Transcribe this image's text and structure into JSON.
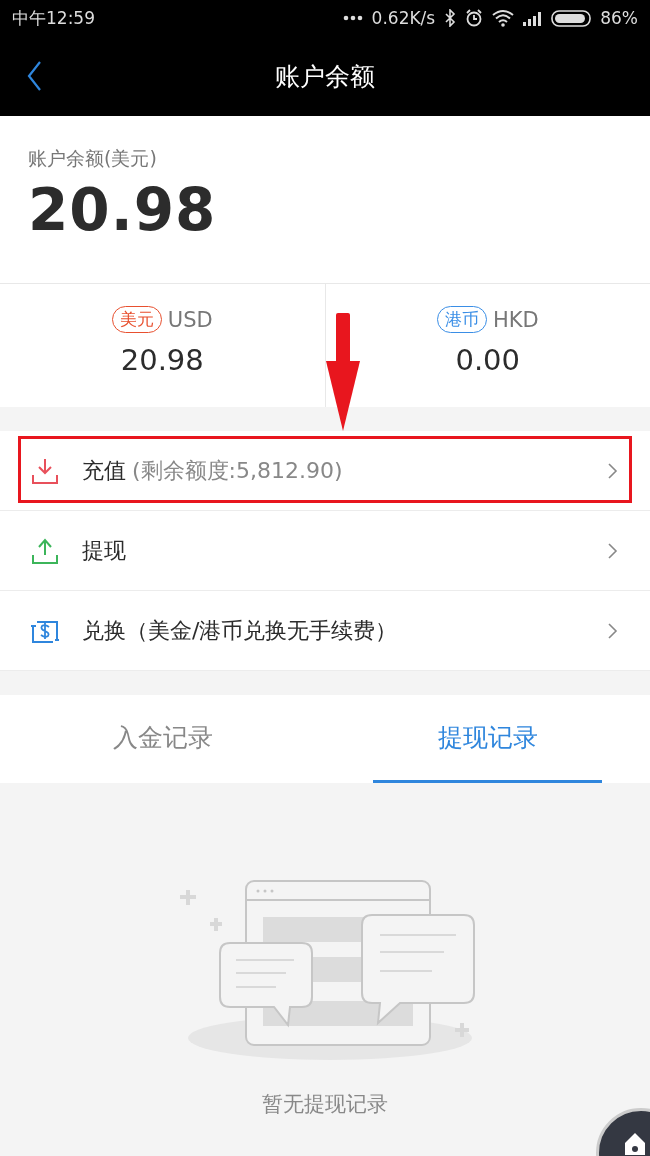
{
  "status_bar": {
    "time": "中午12:59",
    "network_speed": "0.62K/s",
    "battery": "86%"
  },
  "header": {
    "title": "账户余额"
  },
  "balance": {
    "label": "账户余额(美元)",
    "amount": "20.98"
  },
  "currencies": [
    {
      "tag": "美元",
      "code": "USD",
      "amount": "20.98",
      "color": "#e8502f"
    },
    {
      "tag": "港币",
      "code": "HKD",
      "amount": "0.00",
      "color": "#3a8ee6"
    }
  ],
  "actions": [
    {
      "kind": "deposit",
      "label": "充值",
      "note": "(剩余额度:5,812.90)",
      "color": "#e8505b",
      "highlighted": true
    },
    {
      "kind": "withdraw",
      "label": "提现",
      "color": "#3cb55a",
      "highlighted": false
    },
    {
      "kind": "exchange",
      "label": "兑换（美金/港币兑换无手续费）",
      "color": "#2f86dd",
      "highlighted": false
    }
  ],
  "tabs": [
    {
      "label": "入金记录",
      "selected": false
    },
    {
      "label": "提现记录",
      "selected": true
    }
  ],
  "empty_state": {
    "message": "暂无提现记录"
  }
}
